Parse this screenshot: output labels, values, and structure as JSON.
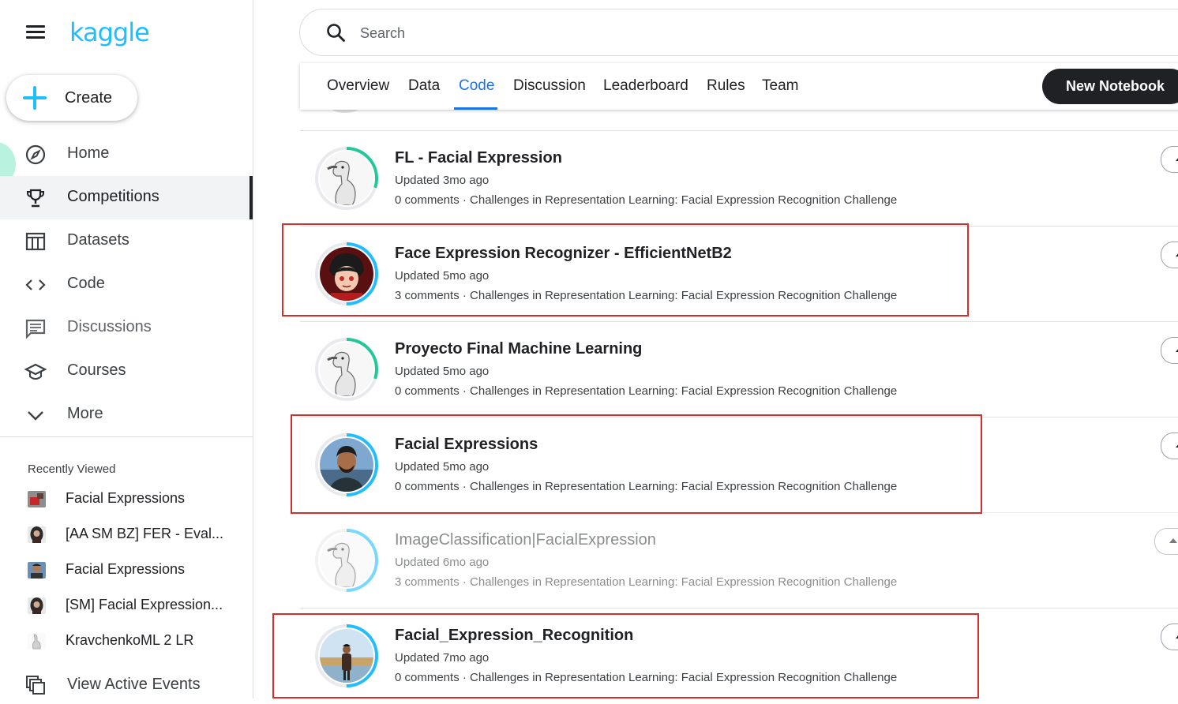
{
  "app": {
    "logo_text": "kaggle",
    "brand_color": "#20beff"
  },
  "sidebar": {
    "create_label": "Create",
    "nav_items": [
      {
        "label": "Home",
        "icon": "compass-icon",
        "active": false
      },
      {
        "label": "Competitions",
        "icon": "trophy-icon",
        "active": true
      },
      {
        "label": "Datasets",
        "icon": "table-icon",
        "active": false
      },
      {
        "label": "Code",
        "icon": "code-brackets-icon",
        "active": false
      },
      {
        "label": "Discussions",
        "icon": "comments-icon",
        "active": false
      },
      {
        "label": "Courses",
        "icon": "graduation-cap-icon",
        "active": false
      },
      {
        "label": "More",
        "icon": "chevron-down-icon",
        "active": false
      }
    ],
    "recently_viewed_title": "Recently Viewed",
    "recently_viewed": [
      {
        "label": "Facial Expressions",
        "thumb": "red-notebook-thumb"
      },
      {
        "label": "[AA SM BZ] FER - Eval...",
        "thumb": "woman-avatar-thumb"
      },
      {
        "label": "Facial Expressions",
        "thumb": "man-avatar-thumb"
      },
      {
        "label": "[SM] Facial Expression...",
        "thumb": "woman-avatar-thumb"
      },
      {
        "label": "KravchenkoML 2 LR",
        "thumb": "goose-thumb"
      }
    ],
    "view_active_events": "View Active Events"
  },
  "search": {
    "placeholder": "Search",
    "value": ""
  },
  "tabs": {
    "items": [
      "Overview",
      "Data",
      "Code",
      "Discussion",
      "Leaderboard",
      "Rules",
      "Team"
    ],
    "active": "Code",
    "new_notebook": "New Notebook"
  },
  "notebooks": [
    {
      "title": "FL - Facial Expression",
      "updated": "Updated 3mo ago",
      "meta": "0 comments · Challenges in Representation Learning: Facial Expression Recognition Challenge",
      "avatar": "goose",
      "ring_color": "#20c997",
      "ring_fraction": 0.3,
      "highlighted": false,
      "faded": false
    },
    {
      "title": "Face Expression Recognizer - EfficientNetB2",
      "updated": "Updated 5mo ago",
      "meta": "3 comments · Challenges in Representation Learning: Facial Expression Recognition Challenge",
      "avatar": "cartoon",
      "ring_color": "#20beff",
      "ring_fraction": 0.5,
      "highlighted": true,
      "faded": false
    },
    {
      "title": "Proyecto Final Machine Learning",
      "updated": "Updated 5mo ago",
      "meta": "0 comments · Challenges in Representation Learning: Facial Expression Recognition Challenge",
      "avatar": "goose",
      "ring_color": "#20c997",
      "ring_fraction": 0.3,
      "highlighted": false,
      "faded": false
    },
    {
      "title": "Facial Expressions",
      "updated": "Updated 5mo ago",
      "meta": "0 comments · Challenges in Representation Learning: Facial Expression Recognition Challenge",
      "avatar": "man",
      "ring_color": "#20beff",
      "ring_fraction": 0.5,
      "highlighted": true,
      "faded": false
    },
    {
      "title": "ImageClassification|FacialExpression",
      "updated": "Updated 6mo ago",
      "meta": "3 comments · Challenges in Representation Learning: Facial Expression Recognition Challenge",
      "avatar": "goose",
      "ring_color": "#20beff",
      "ring_fraction": 0.5,
      "highlighted": false,
      "faded": true
    },
    {
      "title": "Facial_Expression_Recognition",
      "updated": "Updated 7mo ago",
      "meta": "0 comments · Challenges in Representation Learning: Facial Expression Recognition Challenge",
      "avatar": "man-outdoor",
      "ring_color": "#20beff",
      "ring_fraction": 0.5,
      "highlighted": true,
      "faded": false
    }
  ]
}
